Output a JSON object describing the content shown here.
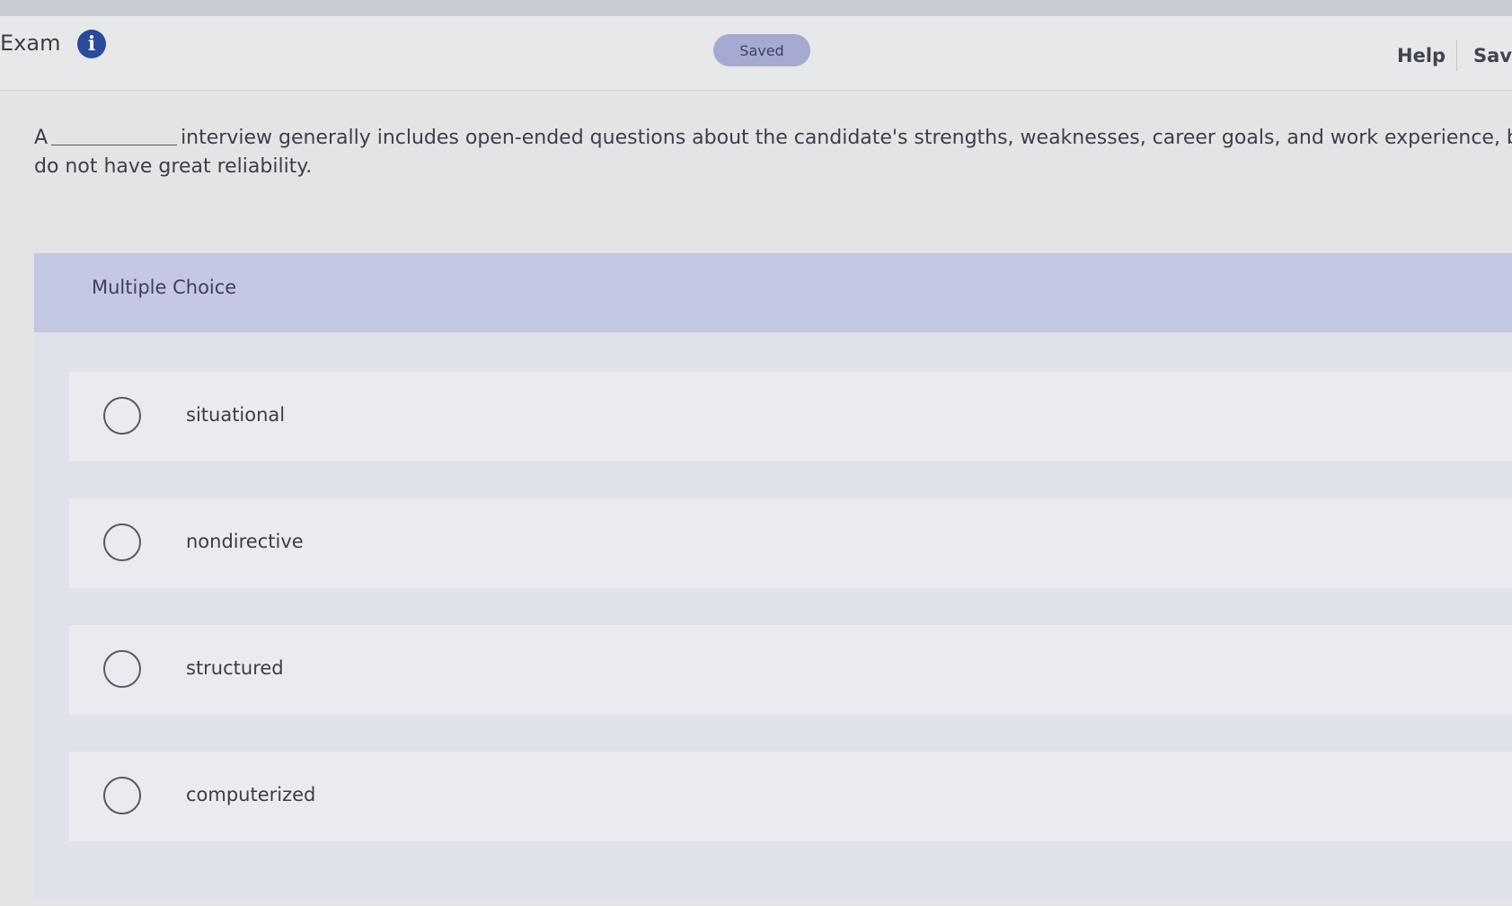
{
  "header": {
    "exam_title": "Exam",
    "info_icon": "info-icon",
    "saved_label": "Saved",
    "help_label": "Help",
    "save_label": "Save"
  },
  "question": {
    "prefix": "A",
    "suffix": "interview generally includes open-ended questions about the candidate's strengths, weaknesses, career goals, and work experience, b",
    "line2": "do not have great reliability."
  },
  "multiple_choice": {
    "header": "Multiple Choice",
    "options": [
      {
        "label": "situational"
      },
      {
        "label": "nondirective"
      },
      {
        "label": "structured"
      },
      {
        "label": "computerized"
      }
    ]
  },
  "colors": {
    "accent": "#2a4a9a",
    "saved_pill": "#a6aad3",
    "mc_header": "#c5c8e3"
  }
}
